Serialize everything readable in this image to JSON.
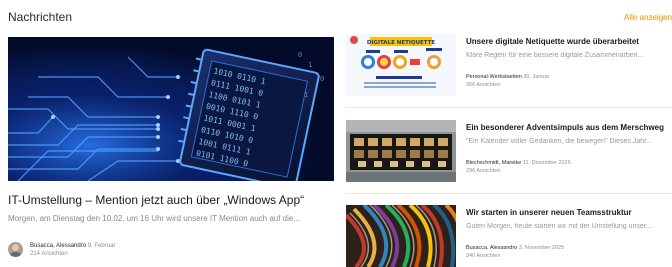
{
  "header": {
    "title": "Nachrichten",
    "show_all": "Alle anzeigen"
  },
  "featured": {
    "title": "IT-Umstellung – Mention jetzt auch über „Windows App“",
    "excerpt": "Morgen, am Dienstag den 10.02. um 16 Uhr wird unsere IT Mention auch auf die...",
    "author": "Busacca, Alessandro",
    "date": "9. Februar",
    "views": "214 Ansichten"
  },
  "news": [
    {
      "title": "Unsere digitale Netiquette wurde überarbeitet",
      "excerpt": "Klare Regeln für eine bessere digitale Zusammenarbeit...",
      "author": "Personal-Werkstaetten",
      "date": "30. Januar",
      "views": "306 Ansichten",
      "thumb_text": "DIGITALE NETIQUETTE"
    },
    {
      "title": "Ein besonderer Adventsimpuls aus dem Merschweg",
      "excerpt": "\"Ein Kalender voller Gedanken, die bewegen\" Dieses Jahr...",
      "author": "Blechschmidt, Mareike",
      "date": "11. Dezember 2025",
      "views": "296 Ansichten"
    },
    {
      "title": "Wir starten in unserer neuen Teamsstruktur",
      "excerpt": "Guten Morgen, heute starten wir mit der Umstellung unser...",
      "author": "Busacca, Alessandro",
      "date": "3. November 2025",
      "views": "340 Ansichten"
    }
  ],
  "colors": {
    "accent": "#f28c00",
    "circuit": "#2e7dff"
  }
}
